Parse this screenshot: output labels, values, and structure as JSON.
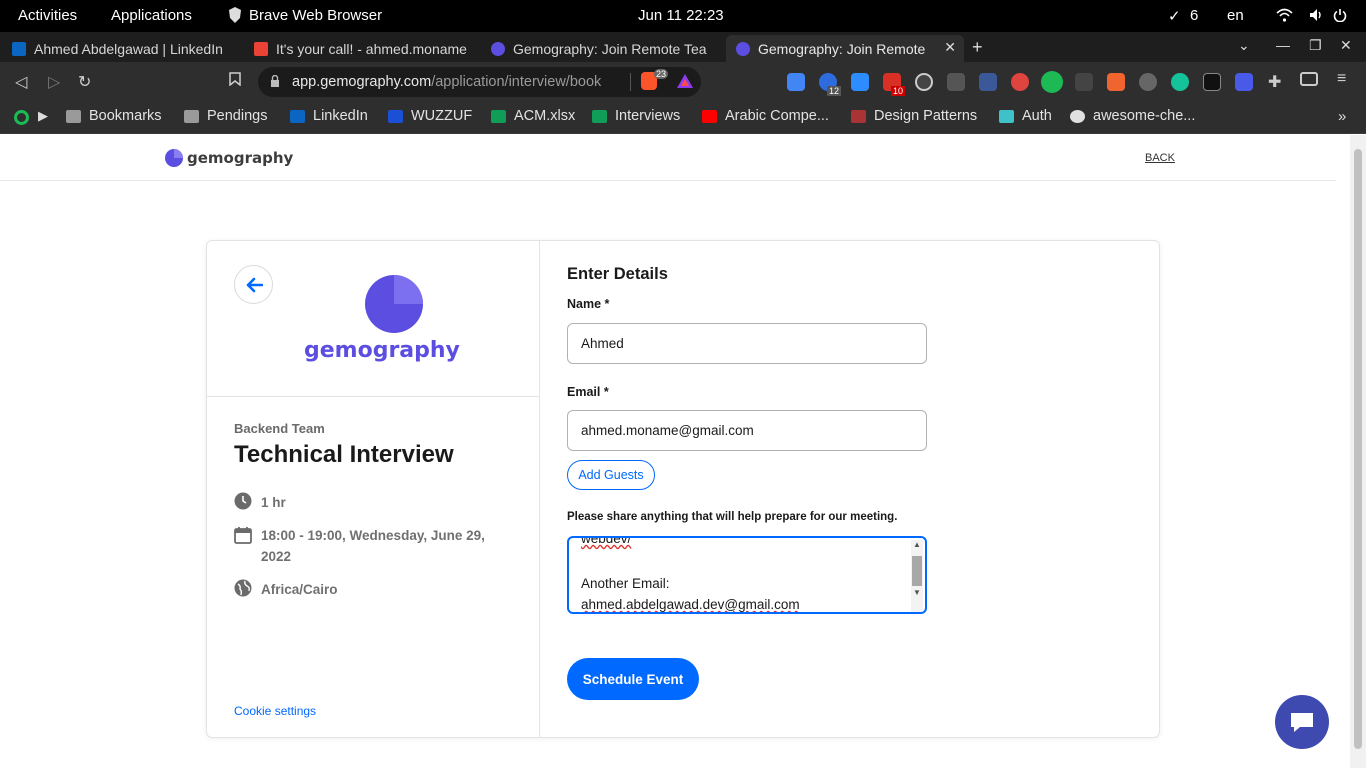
{
  "system": {
    "activities": "Activities",
    "applications": "Applications",
    "app_name": "Brave Web Browser",
    "datetime": "Jun 11  22:23",
    "updates_count": "6",
    "language": "en"
  },
  "tabs": [
    {
      "title": "Ahmed Abdelgawad | LinkedIn",
      "icon": "linkedin-icon"
    },
    {
      "title": "It's your call! - ahmed.moname",
      "icon": "gmail-icon"
    },
    {
      "title": "Gemography: Join Remote Tea",
      "icon": "gemography-icon"
    },
    {
      "title": "Gemography: Join Remote",
      "icon": "gemography-icon",
      "active": true
    }
  ],
  "address_bar": {
    "domain": "app.gemography.com",
    "path": "/application/interview/book",
    "brave_shield_count": "23"
  },
  "extensions": {
    "badge_a": "12",
    "badge_b": "10"
  },
  "bookmarks": [
    {
      "label": "Bookmarks",
      "icon": "folder-icon"
    },
    {
      "label": "Pendings",
      "icon": "folder-icon"
    },
    {
      "label": "LinkedIn",
      "icon": "linkedin-icon"
    },
    {
      "label": "WUZZUF",
      "icon": "wuzzuf-icon"
    },
    {
      "label": "ACM.xlsx",
      "icon": "sheets-icon"
    },
    {
      "label": "Interviews",
      "icon": "sheets-icon"
    },
    {
      "label": "Arabic Compe...",
      "icon": "youtube-icon"
    },
    {
      "label": "Design Patterns",
      "icon": "design-patterns-icon"
    },
    {
      "label": "Auth",
      "icon": "cube-icon"
    },
    {
      "label": "awesome-che...",
      "icon": "github-icon"
    }
  ],
  "site": {
    "logo_text": "gemography",
    "back_link": "BACK"
  },
  "event": {
    "logo_text": "gemography",
    "team": "Backend Team",
    "title": "Technical Interview",
    "duration": "1 hr",
    "datetime_line1": "18:00 - 19:00, Wednesday, June 29,",
    "datetime_line2": "2022",
    "timezone": "Africa/Cairo",
    "cookie_settings": "Cookie settings"
  },
  "form": {
    "heading": "Enter Details",
    "name_label": "Name *",
    "name_value": "Ahmed",
    "email_label": "Email *",
    "email_value": "ahmed.moname@gmail.com",
    "add_guests": "Add Guests",
    "notes_label": "Please share anything that will help prepare for our meeting.",
    "notes_lines": [
      "webdev/",
      "",
      "Another Email:",
      "ahmed.abdelgawad.dev@gmail.com"
    ],
    "submit": "Schedule Event"
  },
  "colors": {
    "accent": "#0069ff",
    "brand_purple": "#5b4ee0",
    "chat_button": "#3e4aaf"
  }
}
